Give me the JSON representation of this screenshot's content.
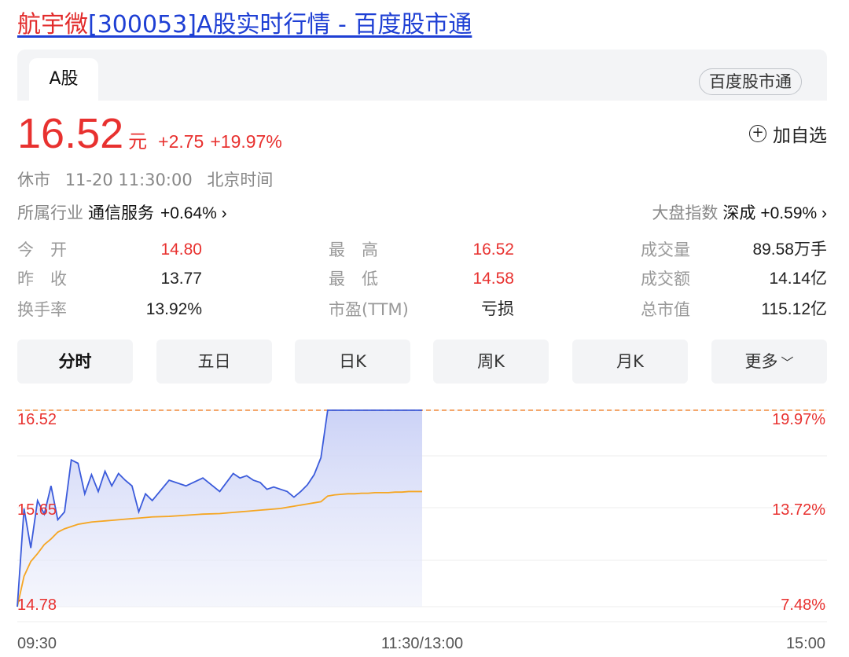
{
  "page_title": {
    "name_part": "航宇微",
    "rest_part": "[300053]A股实时行情 - 百度股市通"
  },
  "tab_active": "A股",
  "brand_badge": "百度股市通",
  "quote": {
    "price": "16.52",
    "unit": "元",
    "change": "+2.75",
    "change_pct": "+19.97%"
  },
  "watch_label": "加自选",
  "status": {
    "state": "休市",
    "datetime": "11-20 11:30:00",
    "timezone": "北京时间"
  },
  "industry": {
    "label": "所属行业",
    "name": "通信服务",
    "value": "+0.64% ›"
  },
  "index": {
    "label": "大盘指数",
    "name": "深成",
    "value": "+0.59% ›"
  },
  "stats": [
    {
      "label": "今　开",
      "value": "14.80",
      "color": "#e8312f"
    },
    {
      "label": "最　高",
      "value": "16.52",
      "color": "#e8312f"
    },
    {
      "label": "成交量",
      "value": "89.58万手",
      "color": "#222222"
    },
    {
      "label": "昨　收",
      "value": "13.77",
      "color": "#222222"
    },
    {
      "label": "最　低",
      "value": "14.58",
      "color": "#e8312f"
    },
    {
      "label": "成交额",
      "value": "14.14亿",
      "color": "#222222"
    },
    {
      "label": "换手率",
      "value": "13.92%",
      "color": "#222222"
    },
    {
      "label": "市盈(TTM)",
      "value": "亏损",
      "color": "#222222"
    },
    {
      "label": "总市值",
      "value": "115.12亿",
      "color": "#222222"
    }
  ],
  "chart_tabs": [
    "分时",
    "五日",
    "日K",
    "周K",
    "月K",
    "更多"
  ],
  "colors": {
    "up": "#e8312f",
    "price_line": "#3b5bdb",
    "avg_line": "#f5a623",
    "limit_line": "#f08a3c"
  },
  "chart_data": {
    "type": "line",
    "price_labels": [
      "16.52",
      "15.65",
      "14.78"
    ],
    "pct_labels": [
      "19.97%",
      "13.72%",
      "7.48%"
    ],
    "time_labels": [
      "09:30",
      "11:30/13:00",
      "15:00"
    ],
    "ylim": [
      14.78,
      16.52
    ],
    "limit_up": 16.52,
    "x_minutes": [
      0,
      2,
      4,
      6,
      8,
      10,
      12,
      14,
      16,
      18,
      20,
      22,
      24,
      26,
      28,
      30,
      32,
      34,
      36,
      38,
      40,
      45,
      50,
      55,
      60,
      62,
      64,
      66,
      68,
      70,
      72,
      74,
      76,
      78,
      80,
      82,
      84,
      86,
      88,
      90,
      92,
      94,
      96,
      98,
      100,
      102,
      104,
      106,
      108,
      110,
      112,
      114,
      116,
      118,
      120
    ],
    "series": [
      {
        "values": [
          14.78,
          15.65,
          15.3,
          15.72,
          15.6,
          15.85,
          15.55,
          15.62,
          16.08,
          16.05,
          15.78,
          15.95,
          15.8,
          15.98,
          15.85,
          15.96,
          15.9,
          15.85,
          15.62,
          15.78,
          15.72,
          15.9,
          15.85,
          15.92,
          15.8,
          15.88,
          15.96,
          15.92,
          15.94,
          15.9,
          15.88,
          15.82,
          15.84,
          15.82,
          15.8,
          15.75,
          15.8,
          15.86,
          15.95,
          16.1,
          16.52,
          16.52,
          16.52,
          16.52,
          16.52,
          16.52,
          16.52,
          16.52,
          16.52,
          16.52,
          16.52,
          16.52,
          16.52,
          16.52,
          16.52
        ]
      },
      {
        "values": [
          14.78,
          15.05,
          15.18,
          15.25,
          15.33,
          15.38,
          15.44,
          15.47,
          15.49,
          15.51,
          15.52,
          15.53,
          15.535,
          15.54,
          15.545,
          15.55,
          15.555,
          15.56,
          15.565,
          15.57,
          15.575,
          15.58,
          15.59,
          15.6,
          15.605,
          15.61,
          15.615,
          15.62,
          15.625,
          15.63,
          15.635,
          15.64,
          15.645,
          15.65,
          15.66,
          15.67,
          15.68,
          15.69,
          15.7,
          15.71,
          15.76,
          15.77,
          15.775,
          15.78,
          15.78,
          15.785,
          15.785,
          15.79,
          15.79,
          15.79,
          15.795,
          15.795,
          15.8,
          15.8,
          15.8
        ]
      }
    ]
  }
}
